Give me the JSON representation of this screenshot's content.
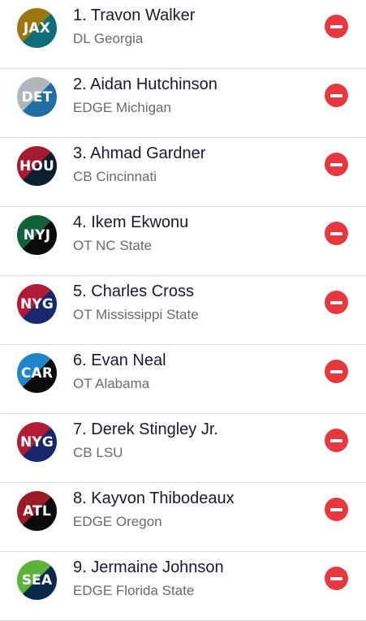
{
  "picks": [
    {
      "rank": "1.",
      "name": "Travon Walker",
      "position": "DL",
      "school": "Georgia",
      "team": {
        "abbr": "JAX",
        "icon": "jaguars-logo-icon",
        "color_a": "#9a7611",
        "color_b": "#0f6d77"
      }
    },
    {
      "rank": "2.",
      "name": "Aidan Hutchinson",
      "position": "EDGE",
      "school": "Michigan",
      "team": {
        "abbr": "DET",
        "icon": "lions-logo-icon",
        "color_a": "#b0b7bc",
        "color_b": "#1f6fa5"
      }
    },
    {
      "rank": "3.",
      "name": "Ahmad Gardner",
      "position": "CB",
      "school": "Cincinnati",
      "team": {
        "abbr": "HOU",
        "icon": "texans-logo-icon",
        "color_a": "#a6192e",
        "color_b": "#0b1f31"
      }
    },
    {
      "rank": "4.",
      "name": "Ikem Ekwonu",
      "position": "OT",
      "school": "NC State",
      "team": {
        "abbr": "NYJ",
        "icon": "jets-logo-icon",
        "color_a": "#11603a",
        "color_b": "#0a0a0a"
      }
    },
    {
      "rank": "5.",
      "name": "Charles Cross",
      "position": "OT",
      "school": "Mississippi State",
      "team": {
        "abbr": "NYG",
        "icon": "giants-logo-icon",
        "color_a": "#b01c35",
        "color_b": "#17286b"
      }
    },
    {
      "rank": "6.",
      "name": "Evan Neal",
      "position": "OT",
      "school": "Alabama",
      "team": {
        "abbr": "CAR",
        "icon": "panthers-logo-icon",
        "color_a": "#1f84c8",
        "color_b": "#0a0a0a"
      }
    },
    {
      "rank": "7.",
      "name": "Derek Stingley Jr.",
      "position": "CB",
      "school": "LSU",
      "team": {
        "abbr": "NYG",
        "icon": "giants-logo-icon",
        "color_a": "#b01c35",
        "color_b": "#17286b"
      }
    },
    {
      "rank": "8.",
      "name": "Kayvon Thibodeaux",
      "position": "EDGE",
      "school": "Oregon",
      "team": {
        "abbr": "ATL",
        "icon": "falcons-logo-icon",
        "color_a": "#9a1a28",
        "color_b": "#0a0a0a"
      }
    },
    {
      "rank": "9.",
      "name": "Jermaine Johnson",
      "position": "EDGE",
      "school": "Florida State",
      "team": {
        "abbr": "SEA",
        "icon": "seahawks-logo-icon",
        "color_a": "#5ab43a",
        "color_b": "#0b2a4a"
      }
    }
  ],
  "remove_button": {
    "icon": "remove-minus-circle-icon",
    "color": "#e8383f"
  }
}
